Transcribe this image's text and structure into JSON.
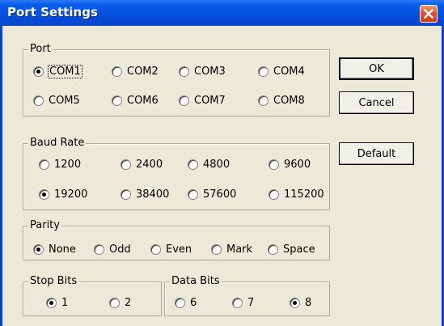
{
  "window": {
    "title": "Port Settings"
  },
  "buttons": {
    "ok": "OK",
    "cancel": "Cancel",
    "default": "Default"
  },
  "port": {
    "label": "Port",
    "options": [
      "COM1",
      "COM2",
      "COM3",
      "COM4",
      "COM5",
      "COM6",
      "COM7",
      "COM8"
    ],
    "selected": "COM1"
  },
  "baud": {
    "label": "Baud Rate",
    "options": [
      "1200",
      "2400",
      "4800",
      "9600",
      "19200",
      "38400",
      "57600",
      "115200"
    ],
    "selected": "19200"
  },
  "parity": {
    "label": "Parity",
    "options": [
      "None",
      "Odd",
      "Even",
      "Mark",
      "Space"
    ],
    "selected": "None"
  },
  "stopbits": {
    "label": "Stop Bits",
    "options": [
      "1",
      "2"
    ],
    "selected": "1"
  },
  "databits": {
    "label": "Data Bits",
    "options": [
      "6",
      "7",
      "8"
    ],
    "selected": "8"
  },
  "icons": {
    "close": "close-icon",
    "radio": "radio-button"
  }
}
